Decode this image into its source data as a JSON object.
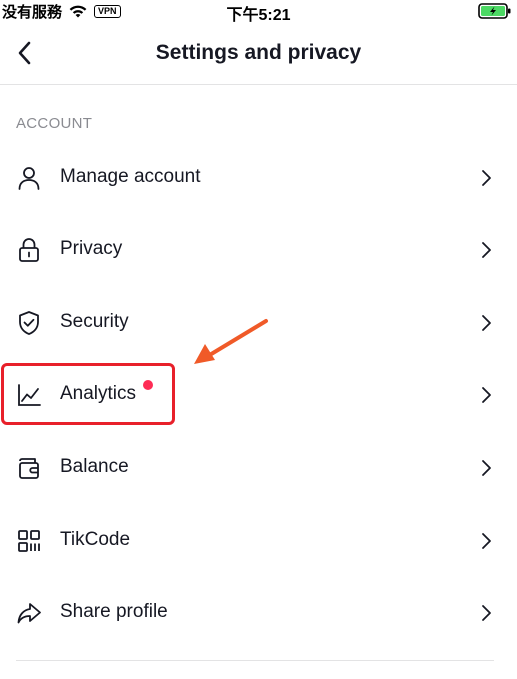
{
  "status_bar": {
    "carrier": "没有服務",
    "vpn": "VPN",
    "time": "下午5:21"
  },
  "header": {
    "title": "Settings and privacy"
  },
  "section": {
    "label": "ACCOUNT"
  },
  "menu": [
    {
      "label": "Manage account",
      "icon": "person-icon"
    },
    {
      "label": "Privacy",
      "icon": "lock-icon"
    },
    {
      "label": "Security",
      "icon": "shield-icon"
    },
    {
      "label": "Analytics",
      "icon": "chart-icon",
      "notification": true
    },
    {
      "label": "Balance",
      "icon": "wallet-icon"
    },
    {
      "label": "TikCode",
      "icon": "qr-code-icon"
    },
    {
      "label": "Share profile",
      "icon": "share-icon"
    }
  ],
  "colors": {
    "text": "#161823",
    "section_label": "#8a8b91",
    "notification_dot": "#fe2c55",
    "highlight": "#e8202a",
    "arrow": "#f05a28",
    "battery": "#4cd964"
  }
}
